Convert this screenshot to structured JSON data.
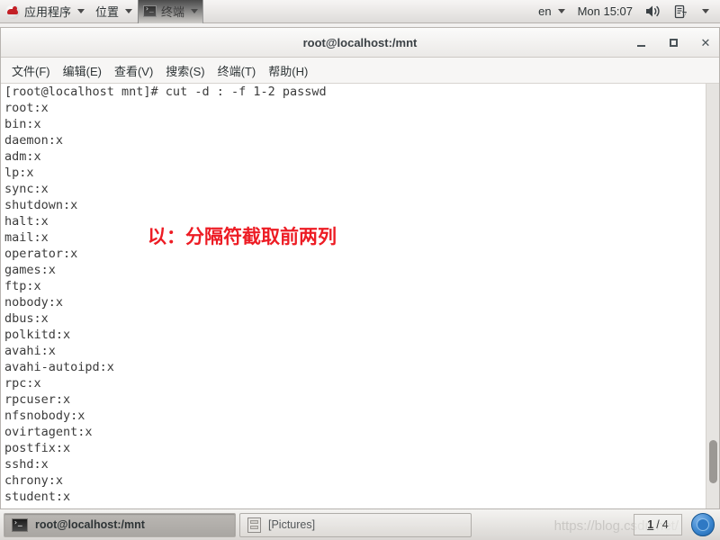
{
  "top_panel": {
    "logo_icon": "redhat-logo-icon",
    "menus": [
      {
        "label": "应用程序",
        "icon": "none"
      },
      {
        "label": "位置",
        "icon": "none"
      }
    ],
    "active_window": {
      "label": "终端",
      "icon": "terminal-icon"
    },
    "keyboard_layout": "en",
    "clock": "Mon 15:07",
    "tray": {
      "volume_icon": "speaker-icon",
      "power_icon": "battery-icon",
      "menu_caret": "chevron-down-icon"
    }
  },
  "window": {
    "title": "root@localhost:/mnt",
    "buttons": {
      "minimize": "minimize-icon",
      "maximize": "maximize-icon",
      "close": "✕"
    },
    "menubar": [
      "文件(F)",
      "编辑(E)",
      "查看(V)",
      "搜索(S)",
      "终端(T)",
      "帮助(H)"
    ]
  },
  "terminal": {
    "prompt": "[root@localhost mnt]# ",
    "command": "cut -d : -f 1-2 passwd",
    "output_lines": [
      "root:x",
      "bin:x",
      "daemon:x",
      "adm:x",
      "lp:x",
      "sync:x",
      "shutdown:x",
      "halt:x",
      "mail:x",
      "operator:x",
      "games:x",
      "ftp:x",
      "nobody:x",
      "dbus:x",
      "polkitd:x",
      "avahi:x",
      "avahi-autoipd:x",
      "rpc:x",
      "rpcuser:x",
      "nfsnobody:x",
      "ovirtagent:x",
      "postfix:x",
      "sshd:x",
      "chrony:x",
      "student:x"
    ],
    "screen_text": "[root@localhost mnt]# cut -d : -f 1-2 passwd\nroot:x\nbin:x\ndaemon:x\nadm:x\nlp:x\nsync:x\nshutdown:x\nhalt:x\nmail:x\noperator:x\ngames:x\nftp:x\nnobody:x\ndbus:x\npolkitd:x\navahi:x\navahi-autoipd:x\nrpc:x\nrpcuser:x\nnfsnobody:x\novirtagent:x\npostfix:x\nsshd:x\nchrony:x\nstudent:x",
    "annotation": {
      "text": "以：分隔符截取前两列",
      "color": "#ed1c24"
    }
  },
  "taskbar": {
    "tasks": [
      {
        "label": "root@localhost:/mnt",
        "icon": "terminal-icon",
        "active": true
      },
      {
        "label": "[Pictures]",
        "icon": "file-manager-icon",
        "active": false
      }
    ],
    "watermark": "https://blog.csdn.net/",
    "workspace": {
      "current": "1",
      "separator": "/",
      "total": "4"
    },
    "trash_icon": "trash-icon"
  }
}
